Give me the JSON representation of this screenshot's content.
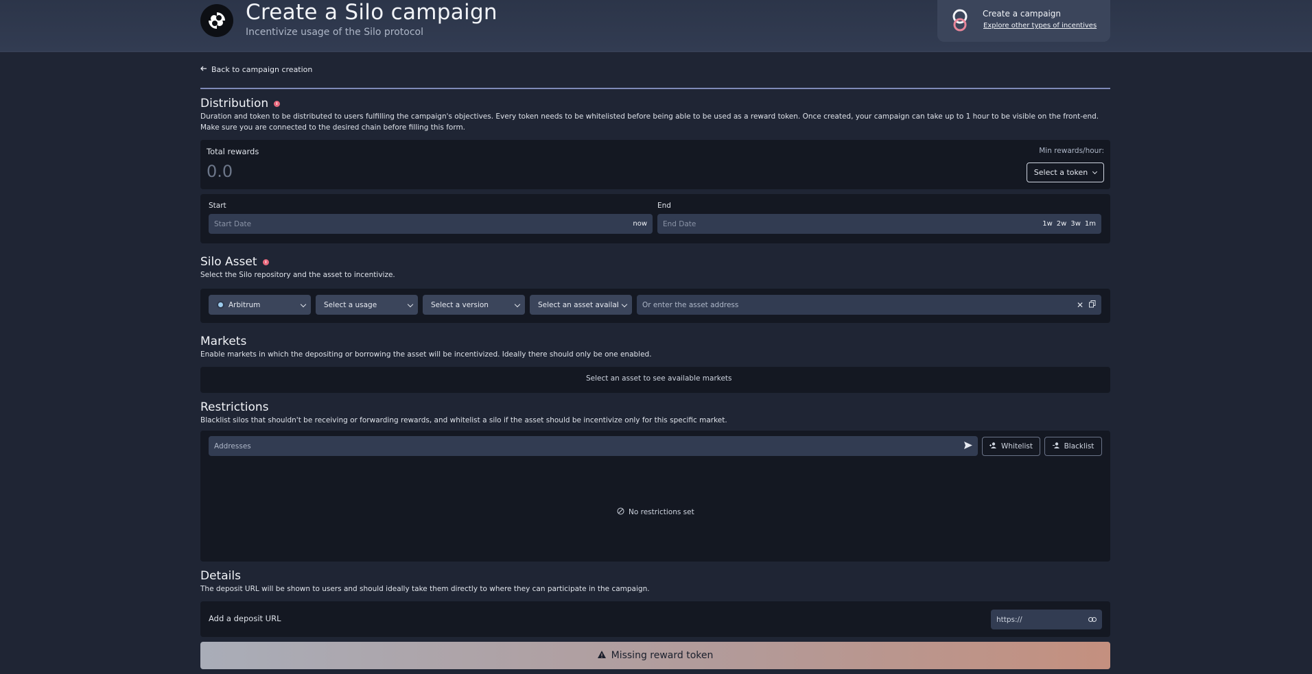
{
  "header": {
    "title": "Create a Silo campaign",
    "subtitle": "Incentivize usage of the Silo protocol",
    "card_title": "Create a campaign",
    "card_link": "Explore other types of incentives"
  },
  "back_link": "Back to campaign creation",
  "distribution": {
    "title": "Distribution",
    "description": "Duration and token to be distributed to users fulfilling the campaign's objectives. Every token needs to be whitelisted before being able to be used as a reward token. Once created, your campaign can take up to 1 hour to be visible on the front-end. Make sure you are connected to the desired chain before filling this form.",
    "total_rewards_label": "Total rewards",
    "total_rewards_value": "0.0",
    "min_rewards_label": "Min rewards/hour:",
    "select_token_label": "Select a token",
    "start_label": "Start",
    "start_placeholder": "Start Date",
    "start_now": "now",
    "end_label": "End",
    "end_placeholder": "End Date",
    "end_chips": [
      "1w",
      "2w",
      "3w",
      "1m"
    ]
  },
  "silo_asset": {
    "title": "Silo Asset",
    "description": "Select the Silo repository and the asset to incentivize.",
    "chain": "Arbitrum",
    "usage": "Select a usage",
    "version": "Select a version",
    "asset": "Select an asset available",
    "address_placeholder": "Or enter the asset address"
  },
  "markets": {
    "title": "Markets",
    "description": "Enable markets in which the depositing or borrowing the asset will be incentivized. Ideally there should only be one enabled.",
    "empty_message": "Select an asset to see available markets"
  },
  "restrictions": {
    "title": "Restrictions",
    "description": "Blacklist silos that shouldn't be receiving or forwarding rewards, and whitelist a silo if the asset should be incentivize only for this specific market.",
    "addresses_placeholder": "Addresses",
    "whitelist_label": "Whitelist",
    "blacklist_label": "Blacklist",
    "empty_message": "No restrictions set"
  },
  "details": {
    "title": "Details",
    "description": "The deposit URL will be shown to users and should ideally take them directly to where they can participate in the campaign.",
    "deposit_label": "Add a deposit URL",
    "url_placeholder": "https://"
  },
  "cta_label": "Missing reward token",
  "colors": {
    "background": "#1f2534",
    "panel": "#141822",
    "field": "#323c52",
    "accent_info": "#e86a7e",
    "divider": "#7f8ab8"
  }
}
